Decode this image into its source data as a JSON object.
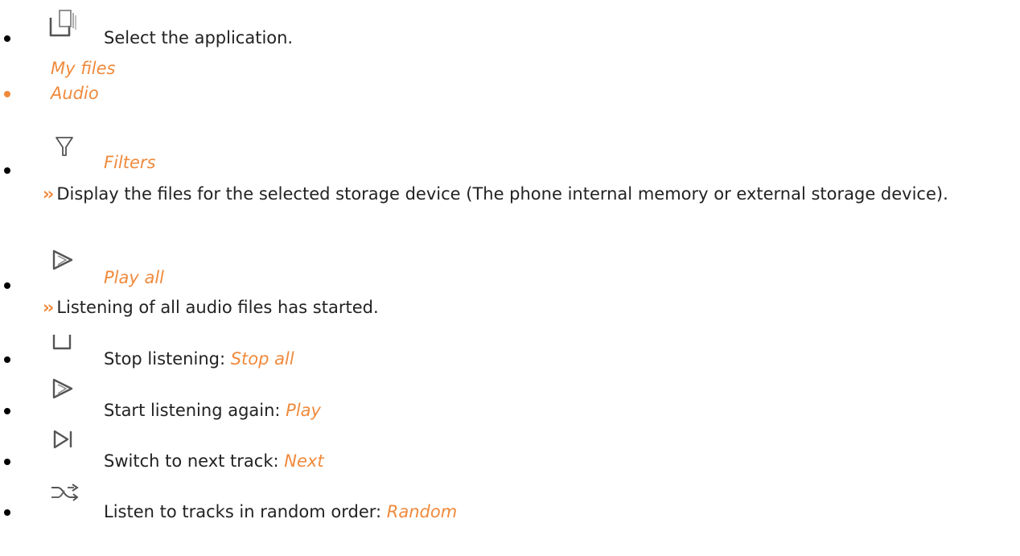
{
  "steps": [
    {
      "kind": "instruction",
      "icon": "apps-icon",
      "text": "Select the application."
    },
    {
      "kind": "menu-path",
      "text": "My files"
    },
    {
      "kind": "menu-path",
      "text": "Audio"
    },
    {
      "kind": "menu-path",
      "icon": "filter-icon",
      "text": "Filters",
      "result": "Display the files for the selected storage device (The phone internal memory or external storage device)."
    },
    {
      "kind": "menu-path",
      "icon": "play-all-icon",
      "text": "Play all",
      "result": "Listening of all audio files has started."
    },
    {
      "kind": "action",
      "icon": "stop-icon",
      "text": "Stop listening: ",
      "option": "Stop all"
    },
    {
      "kind": "action",
      "icon": "play-icon",
      "text": "Start listening again: ",
      "option": "Play"
    },
    {
      "kind": "action",
      "icon": "next-icon",
      "text": "Switch to next track: ",
      "option": "Next"
    },
    {
      "kind": "action",
      "icon": "shuffle-icon",
      "text": "Listen to tracks in random order: ",
      "option": "Random"
    }
  ],
  "result_marker": "››",
  "colors": {
    "accent": "#f08a3c",
    "text": "#222222",
    "icon": "#555555"
  }
}
